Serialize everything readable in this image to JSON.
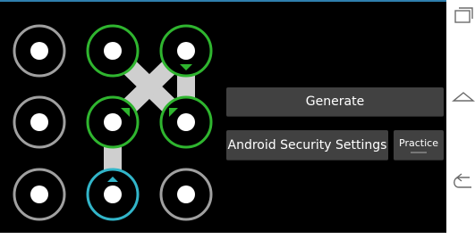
{
  "app": {
    "pattern_grid": {
      "rows": 3,
      "cols": 3,
      "selected_dots": [
        1,
        2,
        4,
        5,
        7
      ],
      "active_dot": 7,
      "path_segments": [
        [
          1,
          5
        ],
        [
          2,
          4
        ],
        [
          2,
          5
        ],
        [
          4,
          7
        ]
      ]
    },
    "buttons": {
      "generate": "Generate",
      "security_settings": "Android Security Settings",
      "practice": "Practice"
    }
  },
  "navigation_bar": {
    "icons": [
      "recent-apps-icon",
      "home-icon",
      "back-icon"
    ]
  },
  "colors": {
    "background": "#000000",
    "dot_idle_ring": "#a0a0a0",
    "dot_selected_ring": "#2fb52f",
    "dot_active_ring": "#32b5c9",
    "path": "#cfcfcf",
    "arrow_selected": "#2fb52f",
    "arrow_active": "#32b5c9",
    "button": "#414141",
    "status_line": "#2f7fae"
  }
}
